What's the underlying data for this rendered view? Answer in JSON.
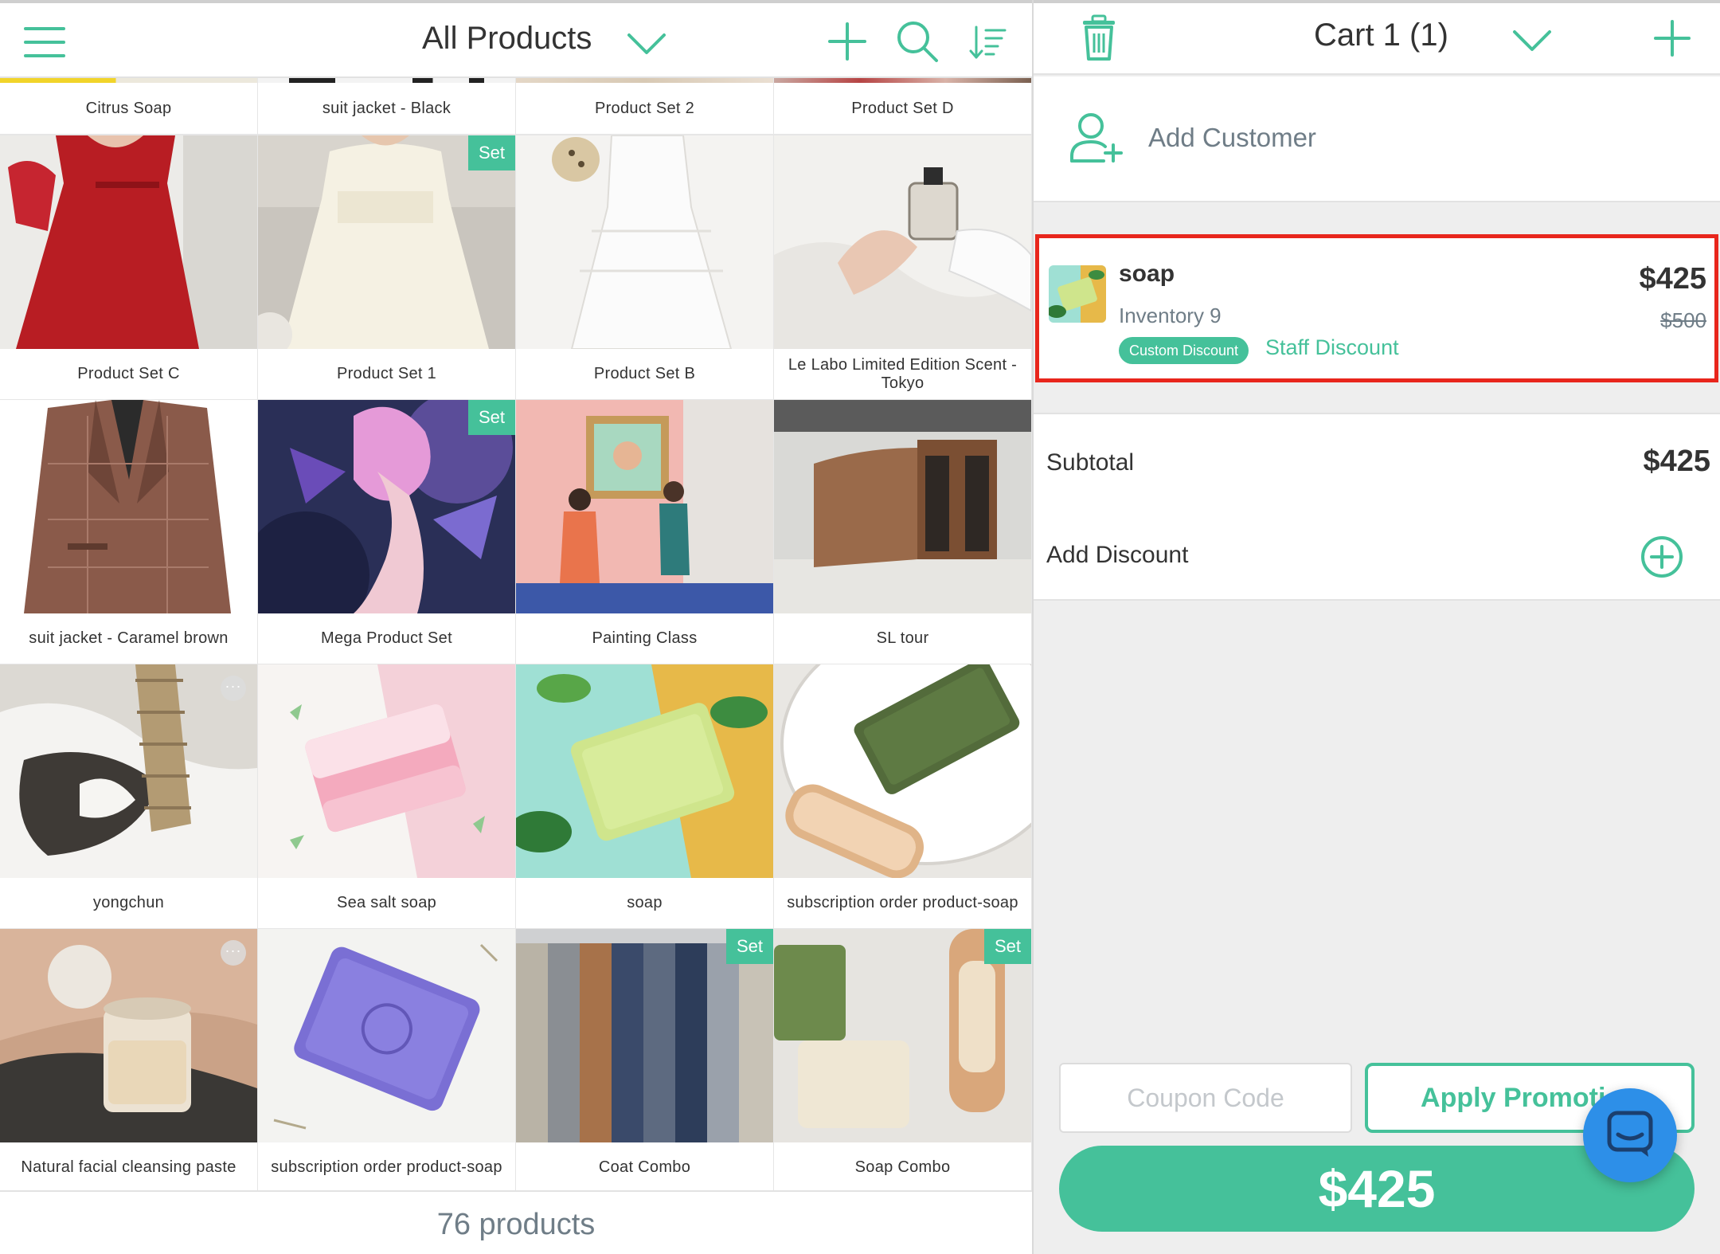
{
  "header": {
    "title": "All Products",
    "icons": {
      "menu": "hamburger-menu-icon",
      "dropdown": "chevron-down-icon",
      "add": "plus-icon",
      "search": "search-icon",
      "sort": "sort-icon"
    }
  },
  "products_top_strip": [
    "Citrus Soap",
    "suit jacket - Black",
    "Product Set 2",
    "Product Set D"
  ],
  "products": [
    {
      "name": "Product Set C",
      "set": false,
      "more": false
    },
    {
      "name": "Product Set 1",
      "set": true,
      "more": false
    },
    {
      "name": "Product Set B",
      "set": false,
      "more": false
    },
    {
      "name": "Le Labo Limited Edition Scent - Tokyo",
      "set": false,
      "more": false
    },
    {
      "name": "suit jacket - Caramel brown",
      "set": false,
      "more": false
    },
    {
      "name": "Mega Product Set",
      "set": true,
      "more": false
    },
    {
      "name": "Painting Class",
      "set": false,
      "more": false
    },
    {
      "name": "SL tour",
      "set": false,
      "more": false
    },
    {
      "name": "yongchun",
      "set": false,
      "more": true
    },
    {
      "name": "Sea salt soap",
      "set": false,
      "more": false
    },
    {
      "name": "soap",
      "set": false,
      "more": false
    },
    {
      "name": "subscription order product-soap",
      "set": false,
      "more": false
    },
    {
      "name": "Natural facial cleansing paste",
      "set": false,
      "more": true
    },
    {
      "name": "subscription order product-soap",
      "set": false,
      "more": false
    },
    {
      "name": "Coat Combo",
      "set": true,
      "more": false
    },
    {
      "name": "Soap Combo",
      "set": true,
      "more": false
    }
  ],
  "set_badge_label": "Set",
  "more_label": "···",
  "footer": {
    "count_text": "76 products"
  },
  "cart": {
    "title": "Cart 1 (1)",
    "icons": {
      "trash": "trash-icon",
      "dropdown": "chevron-down-icon",
      "add": "plus-icon"
    },
    "add_customer_label": "Add Customer",
    "item": {
      "name": "soap",
      "inventory_text": "Inventory 9",
      "discount_badge": "Custom Discount",
      "discount_name": "Staff Discount",
      "price": "$425",
      "original_price": "$500"
    },
    "subtotal_label": "Subtotal",
    "subtotal_value": "$425",
    "add_discount_label": "Add Discount",
    "coupon_placeholder": "Coupon Code",
    "apply_promotion_label": "Apply Promotion",
    "checkout_total": "$425"
  },
  "colors": {
    "accent": "#45c19a",
    "highlight_border": "#e8261c",
    "chat_blue": "#2d8fe8",
    "muted_text": "#6f7d87"
  }
}
